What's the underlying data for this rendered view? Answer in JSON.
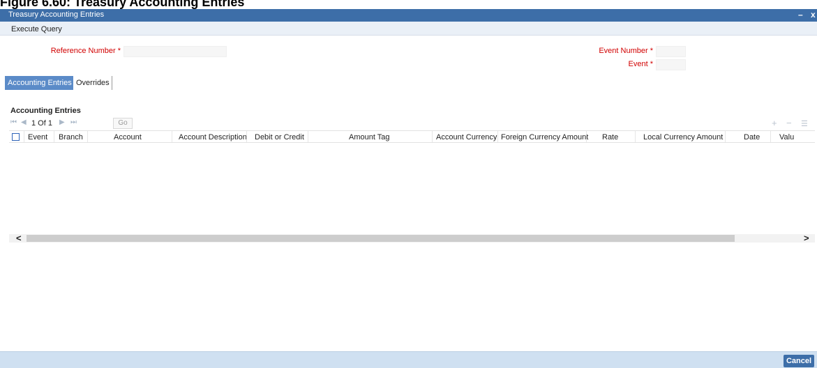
{
  "figure": {
    "caption": "Figure 6.60: Treasury Accounting Entries"
  },
  "window": {
    "title": "Treasury Accounting Entries",
    "minimize": "–",
    "close": "x"
  },
  "menu": {
    "execute_query": "Execute Query"
  },
  "form": {
    "reference_number_label": "Reference Number *",
    "reference_number_value": "",
    "event_number_label": "Event Number *",
    "event_number_value": "",
    "event_label": "Event *",
    "event_value": ""
  },
  "tabs": [
    {
      "label": "Accounting Entries",
      "active": true
    },
    {
      "label": "Overrides",
      "active": false
    }
  ],
  "grid": {
    "title": "Accounting Entries",
    "pager": {
      "text": "1 Of 1",
      "go_label": "Go"
    },
    "icons": [
      "first-page-icon",
      "previous-page-icon",
      "next-page-icon",
      "last-page-icon",
      "add-row-icon",
      "delete-row-icon",
      "single-view-icon"
    ],
    "columns": [
      "Event",
      "Branch",
      "Account",
      "Account Description",
      "Debit or Credit",
      "Amount Tag",
      "Account Currency",
      "Foreign Currency Amount",
      "Rate",
      "Local Currency Amount",
      "Date",
      "Valu"
    ],
    "rows": []
  },
  "scrollbar": {
    "left_arrow": "<",
    "right_arrow": ">"
  },
  "footer": {
    "cancel_label": "Cancel"
  },
  "colors": {
    "titlebar": "#3d6ea8",
    "tab_active": "#5b8bc8",
    "required_label": "#d10000",
    "footer": "#cfe0f1"
  }
}
